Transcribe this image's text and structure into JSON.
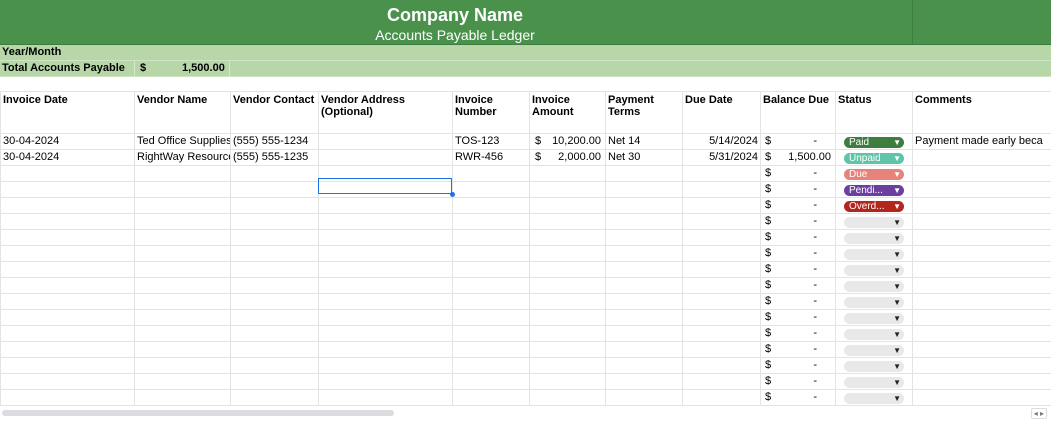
{
  "header": {
    "title": "Company Name",
    "subtitle": "Accounts Payable Ledger"
  },
  "summary": {
    "year_month_label": "Year/Month",
    "total_label": "Total Accounts Payable",
    "total_currency": "$",
    "total_value": "1,500.00"
  },
  "columns": [
    "Invoice Date",
    "Vendor Name",
    "Vendor Contact",
    "Vendor Address (Optional)",
    "Invoice Number",
    "Invoice Amount",
    "Payment Terms",
    "Due Date",
    "Balance Due",
    "Status",
    "Comments"
  ],
  "rows": [
    {
      "invoice_date": "30-04-2024",
      "vendor_name": "Ted Office Supplies",
      "vendor_contact": "(555)  555-1234",
      "vendor_address": "",
      "invoice_number": "TOS-123",
      "amount_currency": "$",
      "amount": "10,200.00",
      "payment_terms": "Net 14",
      "due_date": "5/14/2024",
      "balance_currency": "$",
      "balance": "-",
      "status": "Paid",
      "comments": "Payment made early beca"
    },
    {
      "invoice_date": "30-04-2024",
      "vendor_name": "RightWay Resources",
      "vendor_contact": "(555) 555-1235",
      "vendor_address": "",
      "invoice_number": "RWR-456",
      "amount_currency": "$",
      "amount": "2,000.00",
      "payment_terms": "Net 30",
      "due_date": "5/31/2024",
      "balance_currency": "$",
      "balance": "1,500.00",
      "status": "Unpaid",
      "comments": ""
    },
    {
      "balance_currency": "$",
      "balance": "-",
      "status": "Due"
    },
    {
      "balance_currency": "$",
      "balance": "-",
      "status": "Pendi..."
    },
    {
      "balance_currency": "$",
      "balance": "-",
      "status": "Overd..."
    },
    {
      "balance_currency": "$",
      "balance": "-",
      "status": ""
    },
    {
      "balance_currency": "$",
      "balance": "-",
      "status": ""
    },
    {
      "balance_currency": "$",
      "balance": "-",
      "status": ""
    },
    {
      "balance_currency": "$",
      "balance": "-",
      "status": ""
    },
    {
      "balance_currency": "$",
      "balance": "-",
      "status": ""
    },
    {
      "balance_currency": "$",
      "balance": "-",
      "status": ""
    },
    {
      "balance_currency": "$",
      "balance": "-",
      "status": ""
    },
    {
      "balance_currency": "$",
      "balance": "-",
      "status": ""
    },
    {
      "balance_currency": "$",
      "balance": "-",
      "status": ""
    },
    {
      "balance_currency": "$",
      "balance": "-",
      "status": ""
    },
    {
      "balance_currency": "$",
      "balance": "-",
      "status": ""
    },
    {
      "balance_currency": "$",
      "balance": "-",
      "status": ""
    }
  ],
  "status_colors": {
    "Paid": {
      "bg": "#3d7d40",
      "fg": "#ffffff"
    },
    "Unpaid": {
      "bg": "#5ec5a8",
      "fg": "#ffffff"
    },
    "Due": {
      "bg": "#e6837a",
      "fg": "#ffffff"
    },
    "Pendi...": {
      "bg": "#6b3fa0",
      "fg": "#ffffff"
    },
    "Overd...": {
      "bg": "#b3261e",
      "fg": "#ffffff"
    },
    "": {
      "bg": "#e8e8e8",
      "fg": "#000000"
    }
  },
  "icons": {
    "dropdown": "caret-down-icon",
    "scroll_left": "chevron-left-icon",
    "scroll_right": "chevron-right-icon"
  }
}
